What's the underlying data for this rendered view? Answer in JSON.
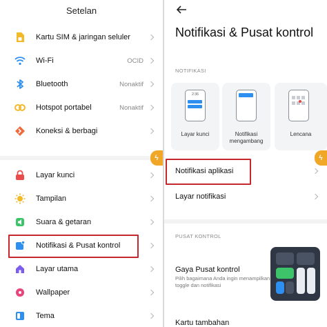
{
  "left": {
    "title": "Setelan",
    "items_top": [
      {
        "label": "Kartu SIM & jaringan seluler",
        "value": "",
        "icon": "sim-card-icon",
        "color": "#f3b928"
      },
      {
        "label": "Wi-Fi",
        "value": "OCID",
        "icon": "wifi-icon",
        "color": "#2d8ff0"
      },
      {
        "label": "Bluetooth",
        "value": "Nonaktif",
        "icon": "bluetooth-icon",
        "color": "#2d8ff0"
      },
      {
        "label": "Hotspot portabel",
        "value": "Nonaktif",
        "icon": "hotspot-icon",
        "color": "#f3b928"
      },
      {
        "label": "Koneksi & berbagi",
        "value": "",
        "icon": "share-icon",
        "color": "#ef6a3a"
      }
    ],
    "items_bottom": [
      {
        "label": "Layar kunci",
        "value": "",
        "icon": "lock-icon",
        "color": "#ea4b4b"
      },
      {
        "label": "Tampilan",
        "value": "",
        "icon": "brightness-icon",
        "color": "#f3b928"
      },
      {
        "label": "Suara & getaran",
        "value": "",
        "icon": "speaker-icon",
        "color": "#3dc46a"
      },
      {
        "label": "Notifikasi & Pusat kontrol",
        "value": "",
        "icon": "notification-icon",
        "color": "#2d8ff0"
      },
      {
        "label": "Layar utama",
        "value": "",
        "icon": "home-icon",
        "color": "#7d5cf0"
      },
      {
        "label": "Wallpaper",
        "value": "",
        "icon": "wallpaper-icon",
        "color": "#e8457a"
      },
      {
        "label": "Tema",
        "value": "",
        "icon": "theme-icon",
        "color": "#2d8ff0"
      }
    ]
  },
  "right": {
    "title": "Notifikasi & Pusat kontrol",
    "section_notif": "NOTIFIKASI",
    "cards": [
      {
        "label": "Layar kunci",
        "time": "2:36"
      },
      {
        "label": "Notifikasi mengambang"
      },
      {
        "label": "Lencana"
      }
    ],
    "app_notifications": "Notifikasi aplikasi",
    "notif_shade": "Layar notifikasi",
    "section_cc": "PUSAT KONTROL",
    "cc_style_title": "Gaya Pusat kontrol",
    "cc_style_sub": "Pilih bagaimana Anda ingin menampilkan toggle dan notifikasi",
    "extra_tiles": "Kartu tambahan"
  },
  "accent_red": "#c6272c"
}
